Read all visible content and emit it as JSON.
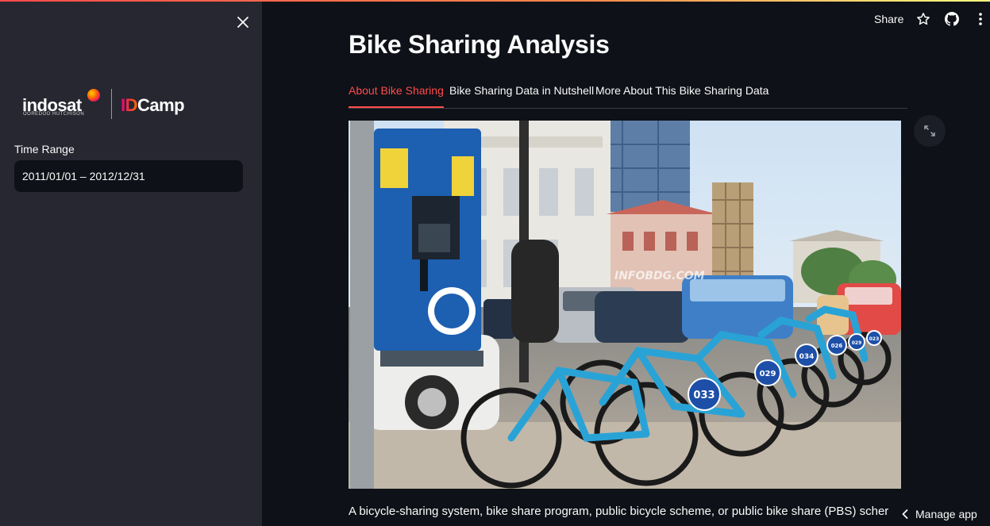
{
  "sidebar": {
    "logo": {
      "brand": "indosat",
      "brand_sub": "OOREDOO HUTCHISON",
      "partner_id": "ID",
      "partner_rest": "Camp"
    },
    "date_label": "Time Range",
    "date_value": "2011/01/01 – 2012/12/31"
  },
  "toolbar": {
    "share_label": "Share"
  },
  "main": {
    "title": "Bike Sharing Analysis",
    "tabs": [
      {
        "label": "About Bike Sharing",
        "active": true
      },
      {
        "label": "Bike Sharing Data in Nutshell",
        "active": false
      },
      {
        "label": "More About This Bike Sharing Data",
        "active": false
      }
    ],
    "image": {
      "watermark": "INFOBDG.COM",
      "bike_numbers": [
        "033",
        "029",
        "034",
        "026",
        "029",
        "023"
      ]
    },
    "caption": "A bicycle-sharing system, bike share program, public bicycle scheme, or public bike share (PBS) scher"
  },
  "footer": {
    "manage_label": "Manage app"
  },
  "colors": {
    "accent": "#ff4b4b",
    "background": "#0e1117",
    "sidebar": "#262730",
    "bike_frame": "#29a3d6",
    "kiosk": "#1d5fb0"
  }
}
